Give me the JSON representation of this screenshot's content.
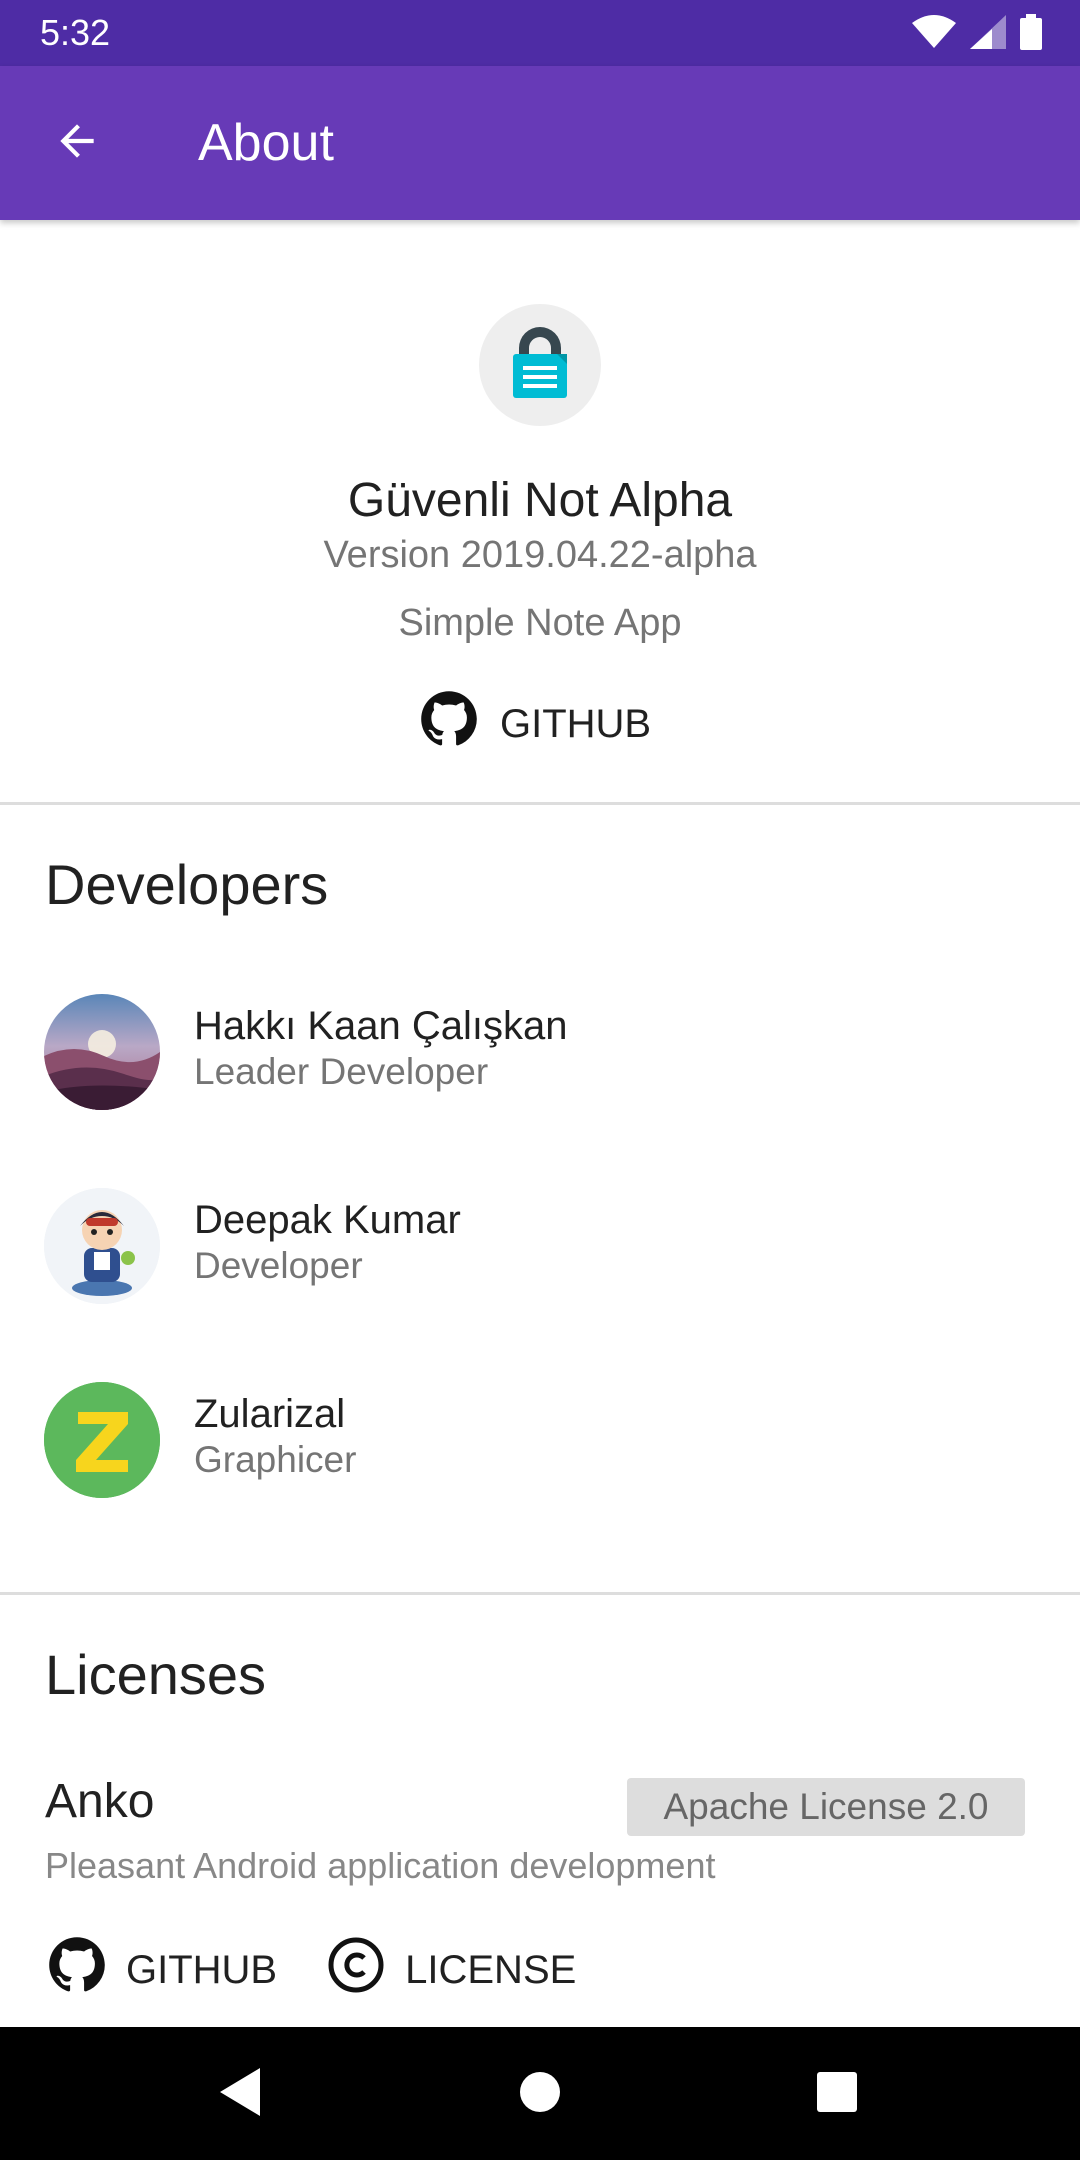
{
  "status_bar": {
    "time": "5:32",
    "icons": [
      "wifi-icon",
      "cellular-signal-icon",
      "battery-icon"
    ]
  },
  "app_bar": {
    "title": "About",
    "back_icon": "arrow-back-icon",
    "background_color": "#673ab7"
  },
  "app_info": {
    "icon": "secure-note-icon",
    "name": "Güvenli Not Alpha",
    "version": "Version 2019.04.22-alpha",
    "description": "Simple Note App",
    "github_label": "GITHUB"
  },
  "developers": {
    "title": "Developers",
    "items": [
      {
        "name": "Hakkı Kaan Çalışkan",
        "role": "Leader Developer",
        "avatar": "landscape-avatar"
      },
      {
        "name": "Deepak Kumar",
        "role": "Developer",
        "avatar": "cartoon-avatar"
      },
      {
        "name": "Zularizal",
        "role": "Graphicer",
        "avatar": "letter-z-avatar"
      }
    ]
  },
  "licenses": {
    "title": "Licenses",
    "items": [
      {
        "name": "Anko",
        "license": "Apache License 2.0",
        "description": "Pleasant Android application development",
        "github_label": "GITHUB",
        "license_label": "LICENSE"
      }
    ]
  },
  "nav_bar": {
    "buttons": [
      "back-triangle-icon",
      "home-circle-icon",
      "recents-square-icon"
    ]
  }
}
